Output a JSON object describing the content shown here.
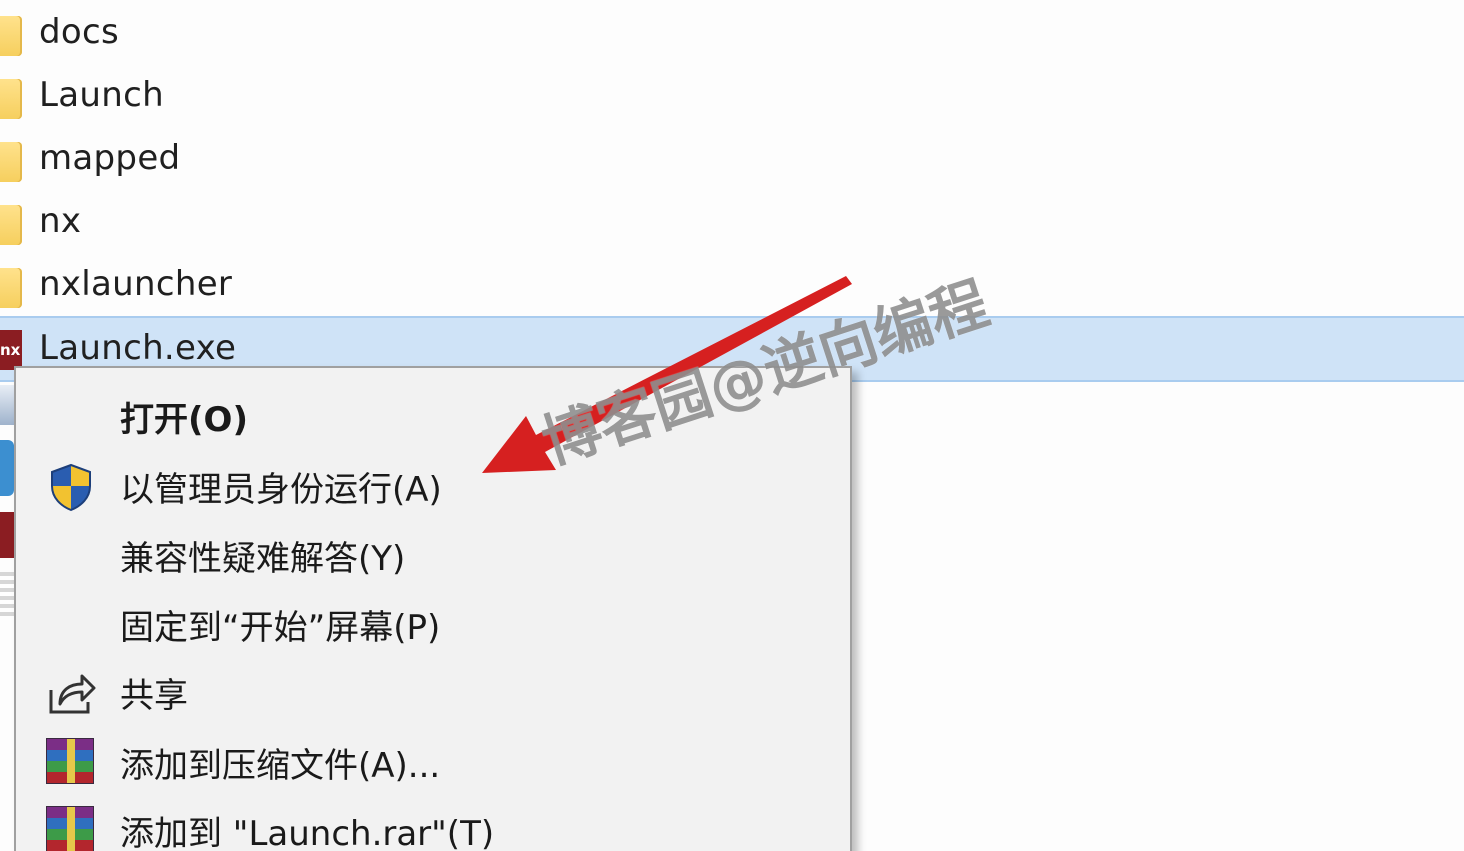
{
  "files": [
    {
      "name": "docs",
      "type": "folder"
    },
    {
      "name": "Launch",
      "type": "folder"
    },
    {
      "name": "mapped",
      "type": "folder"
    },
    {
      "name": "nx",
      "type": "folder"
    },
    {
      "name": "nxlauncher",
      "type": "folder"
    },
    {
      "name": "Launch.exe",
      "type": "exe",
      "icon_text": "nx",
      "selected": true
    }
  ],
  "context_menu": {
    "items": [
      {
        "label": "打开(O)",
        "icon": null,
        "bold": true
      },
      {
        "label": "以管理员身份运行(A)",
        "icon": "uac-shield-icon"
      },
      {
        "label": "兼容性疑难解答(Y)",
        "icon": null
      },
      {
        "label": "固定到“开始”屏幕(P)",
        "icon": null
      },
      {
        "label": "共享",
        "icon": "share-icon"
      },
      {
        "label": "添加到压缩文件(A)...",
        "icon": "winrar-icon"
      },
      {
        "label": "添加到 \"Launch.rar\"(T)",
        "icon": "winrar-icon"
      }
    ]
  },
  "watermark": {
    "text": "博客园@逆向编程"
  },
  "colors": {
    "selection": "#cfe3f7",
    "menu_bg": "#f2f2f2",
    "arrow": "#d62020",
    "folder": "#f6cf5e"
  }
}
